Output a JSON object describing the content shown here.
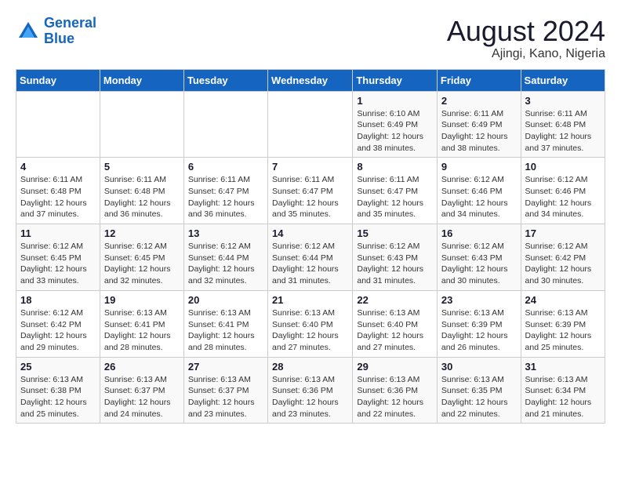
{
  "logo": {
    "line1": "General",
    "line2": "Blue"
  },
  "title": {
    "month_year": "August 2024",
    "location": "Ajingi, Kano, Nigeria"
  },
  "weekdays": [
    "Sunday",
    "Monday",
    "Tuesday",
    "Wednesday",
    "Thursday",
    "Friday",
    "Saturday"
  ],
  "weeks": [
    [
      {
        "day": "",
        "info": ""
      },
      {
        "day": "",
        "info": ""
      },
      {
        "day": "",
        "info": ""
      },
      {
        "day": "",
        "info": ""
      },
      {
        "day": "1",
        "info": "Sunrise: 6:10 AM\nSunset: 6:49 PM\nDaylight: 12 hours\nand 38 minutes."
      },
      {
        "day": "2",
        "info": "Sunrise: 6:11 AM\nSunset: 6:49 PM\nDaylight: 12 hours\nand 38 minutes."
      },
      {
        "day": "3",
        "info": "Sunrise: 6:11 AM\nSunset: 6:48 PM\nDaylight: 12 hours\nand 37 minutes."
      }
    ],
    [
      {
        "day": "4",
        "info": "Sunrise: 6:11 AM\nSunset: 6:48 PM\nDaylight: 12 hours\nand 37 minutes."
      },
      {
        "day": "5",
        "info": "Sunrise: 6:11 AM\nSunset: 6:48 PM\nDaylight: 12 hours\nand 36 minutes."
      },
      {
        "day": "6",
        "info": "Sunrise: 6:11 AM\nSunset: 6:47 PM\nDaylight: 12 hours\nand 36 minutes."
      },
      {
        "day": "7",
        "info": "Sunrise: 6:11 AM\nSunset: 6:47 PM\nDaylight: 12 hours\nand 35 minutes."
      },
      {
        "day": "8",
        "info": "Sunrise: 6:11 AM\nSunset: 6:47 PM\nDaylight: 12 hours\nand 35 minutes."
      },
      {
        "day": "9",
        "info": "Sunrise: 6:12 AM\nSunset: 6:46 PM\nDaylight: 12 hours\nand 34 minutes."
      },
      {
        "day": "10",
        "info": "Sunrise: 6:12 AM\nSunset: 6:46 PM\nDaylight: 12 hours\nand 34 minutes."
      }
    ],
    [
      {
        "day": "11",
        "info": "Sunrise: 6:12 AM\nSunset: 6:45 PM\nDaylight: 12 hours\nand 33 minutes."
      },
      {
        "day": "12",
        "info": "Sunrise: 6:12 AM\nSunset: 6:45 PM\nDaylight: 12 hours\nand 32 minutes."
      },
      {
        "day": "13",
        "info": "Sunrise: 6:12 AM\nSunset: 6:44 PM\nDaylight: 12 hours\nand 32 minutes."
      },
      {
        "day": "14",
        "info": "Sunrise: 6:12 AM\nSunset: 6:44 PM\nDaylight: 12 hours\nand 31 minutes."
      },
      {
        "day": "15",
        "info": "Sunrise: 6:12 AM\nSunset: 6:43 PM\nDaylight: 12 hours\nand 31 minutes."
      },
      {
        "day": "16",
        "info": "Sunrise: 6:12 AM\nSunset: 6:43 PM\nDaylight: 12 hours\nand 30 minutes."
      },
      {
        "day": "17",
        "info": "Sunrise: 6:12 AM\nSunset: 6:42 PM\nDaylight: 12 hours\nand 30 minutes."
      }
    ],
    [
      {
        "day": "18",
        "info": "Sunrise: 6:12 AM\nSunset: 6:42 PM\nDaylight: 12 hours\nand 29 minutes."
      },
      {
        "day": "19",
        "info": "Sunrise: 6:13 AM\nSunset: 6:41 PM\nDaylight: 12 hours\nand 28 minutes."
      },
      {
        "day": "20",
        "info": "Sunrise: 6:13 AM\nSunset: 6:41 PM\nDaylight: 12 hours\nand 28 minutes."
      },
      {
        "day": "21",
        "info": "Sunrise: 6:13 AM\nSunset: 6:40 PM\nDaylight: 12 hours\nand 27 minutes."
      },
      {
        "day": "22",
        "info": "Sunrise: 6:13 AM\nSunset: 6:40 PM\nDaylight: 12 hours\nand 27 minutes."
      },
      {
        "day": "23",
        "info": "Sunrise: 6:13 AM\nSunset: 6:39 PM\nDaylight: 12 hours\nand 26 minutes."
      },
      {
        "day": "24",
        "info": "Sunrise: 6:13 AM\nSunset: 6:39 PM\nDaylight: 12 hours\nand 25 minutes."
      }
    ],
    [
      {
        "day": "25",
        "info": "Sunrise: 6:13 AM\nSunset: 6:38 PM\nDaylight: 12 hours\nand 25 minutes."
      },
      {
        "day": "26",
        "info": "Sunrise: 6:13 AM\nSunset: 6:37 PM\nDaylight: 12 hours\nand 24 minutes."
      },
      {
        "day": "27",
        "info": "Sunrise: 6:13 AM\nSunset: 6:37 PM\nDaylight: 12 hours\nand 23 minutes."
      },
      {
        "day": "28",
        "info": "Sunrise: 6:13 AM\nSunset: 6:36 PM\nDaylight: 12 hours\nand 23 minutes."
      },
      {
        "day": "29",
        "info": "Sunrise: 6:13 AM\nSunset: 6:36 PM\nDaylight: 12 hours\nand 22 minutes."
      },
      {
        "day": "30",
        "info": "Sunrise: 6:13 AM\nSunset: 6:35 PM\nDaylight: 12 hours\nand 22 minutes."
      },
      {
        "day": "31",
        "info": "Sunrise: 6:13 AM\nSunset: 6:34 PM\nDaylight: 12 hours\nand 21 minutes."
      }
    ]
  ]
}
